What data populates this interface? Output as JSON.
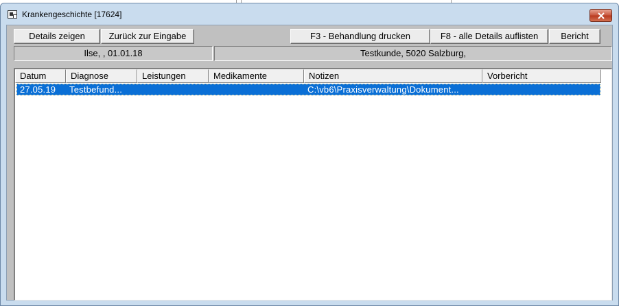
{
  "window": {
    "title": "Krankengeschichte [17624]",
    "accent": "#c9dcee",
    "close_color": "#c8563c"
  },
  "toolbar": {
    "details_label": "Details zeigen",
    "back_label": "Zurück zur Eingabe",
    "print_label": "F3 - Behandlung drucken",
    "list_all_label": "F8 - alle Details auflisten",
    "report_label": "Bericht"
  },
  "patient": {
    "info": "Ilse,   , 01.01.18"
  },
  "customer": {
    "info": "Testkunde, 5020 Salzburg,"
  },
  "table": {
    "columns": [
      "Datum",
      "Diagnose",
      "Leistungen",
      "Medikamente",
      "Notizen",
      "Vorbericht"
    ],
    "rows": [
      {
        "datum": "27.05.19",
        "diagnose": "Testbefund...",
        "leistungen": "",
        "medikamente": "",
        "notizen": "C:\\vb6\\Praxisverwaltung\\Dokument...",
        "vorbericht": ""
      }
    ],
    "selected_color": "#0a6fd6"
  }
}
